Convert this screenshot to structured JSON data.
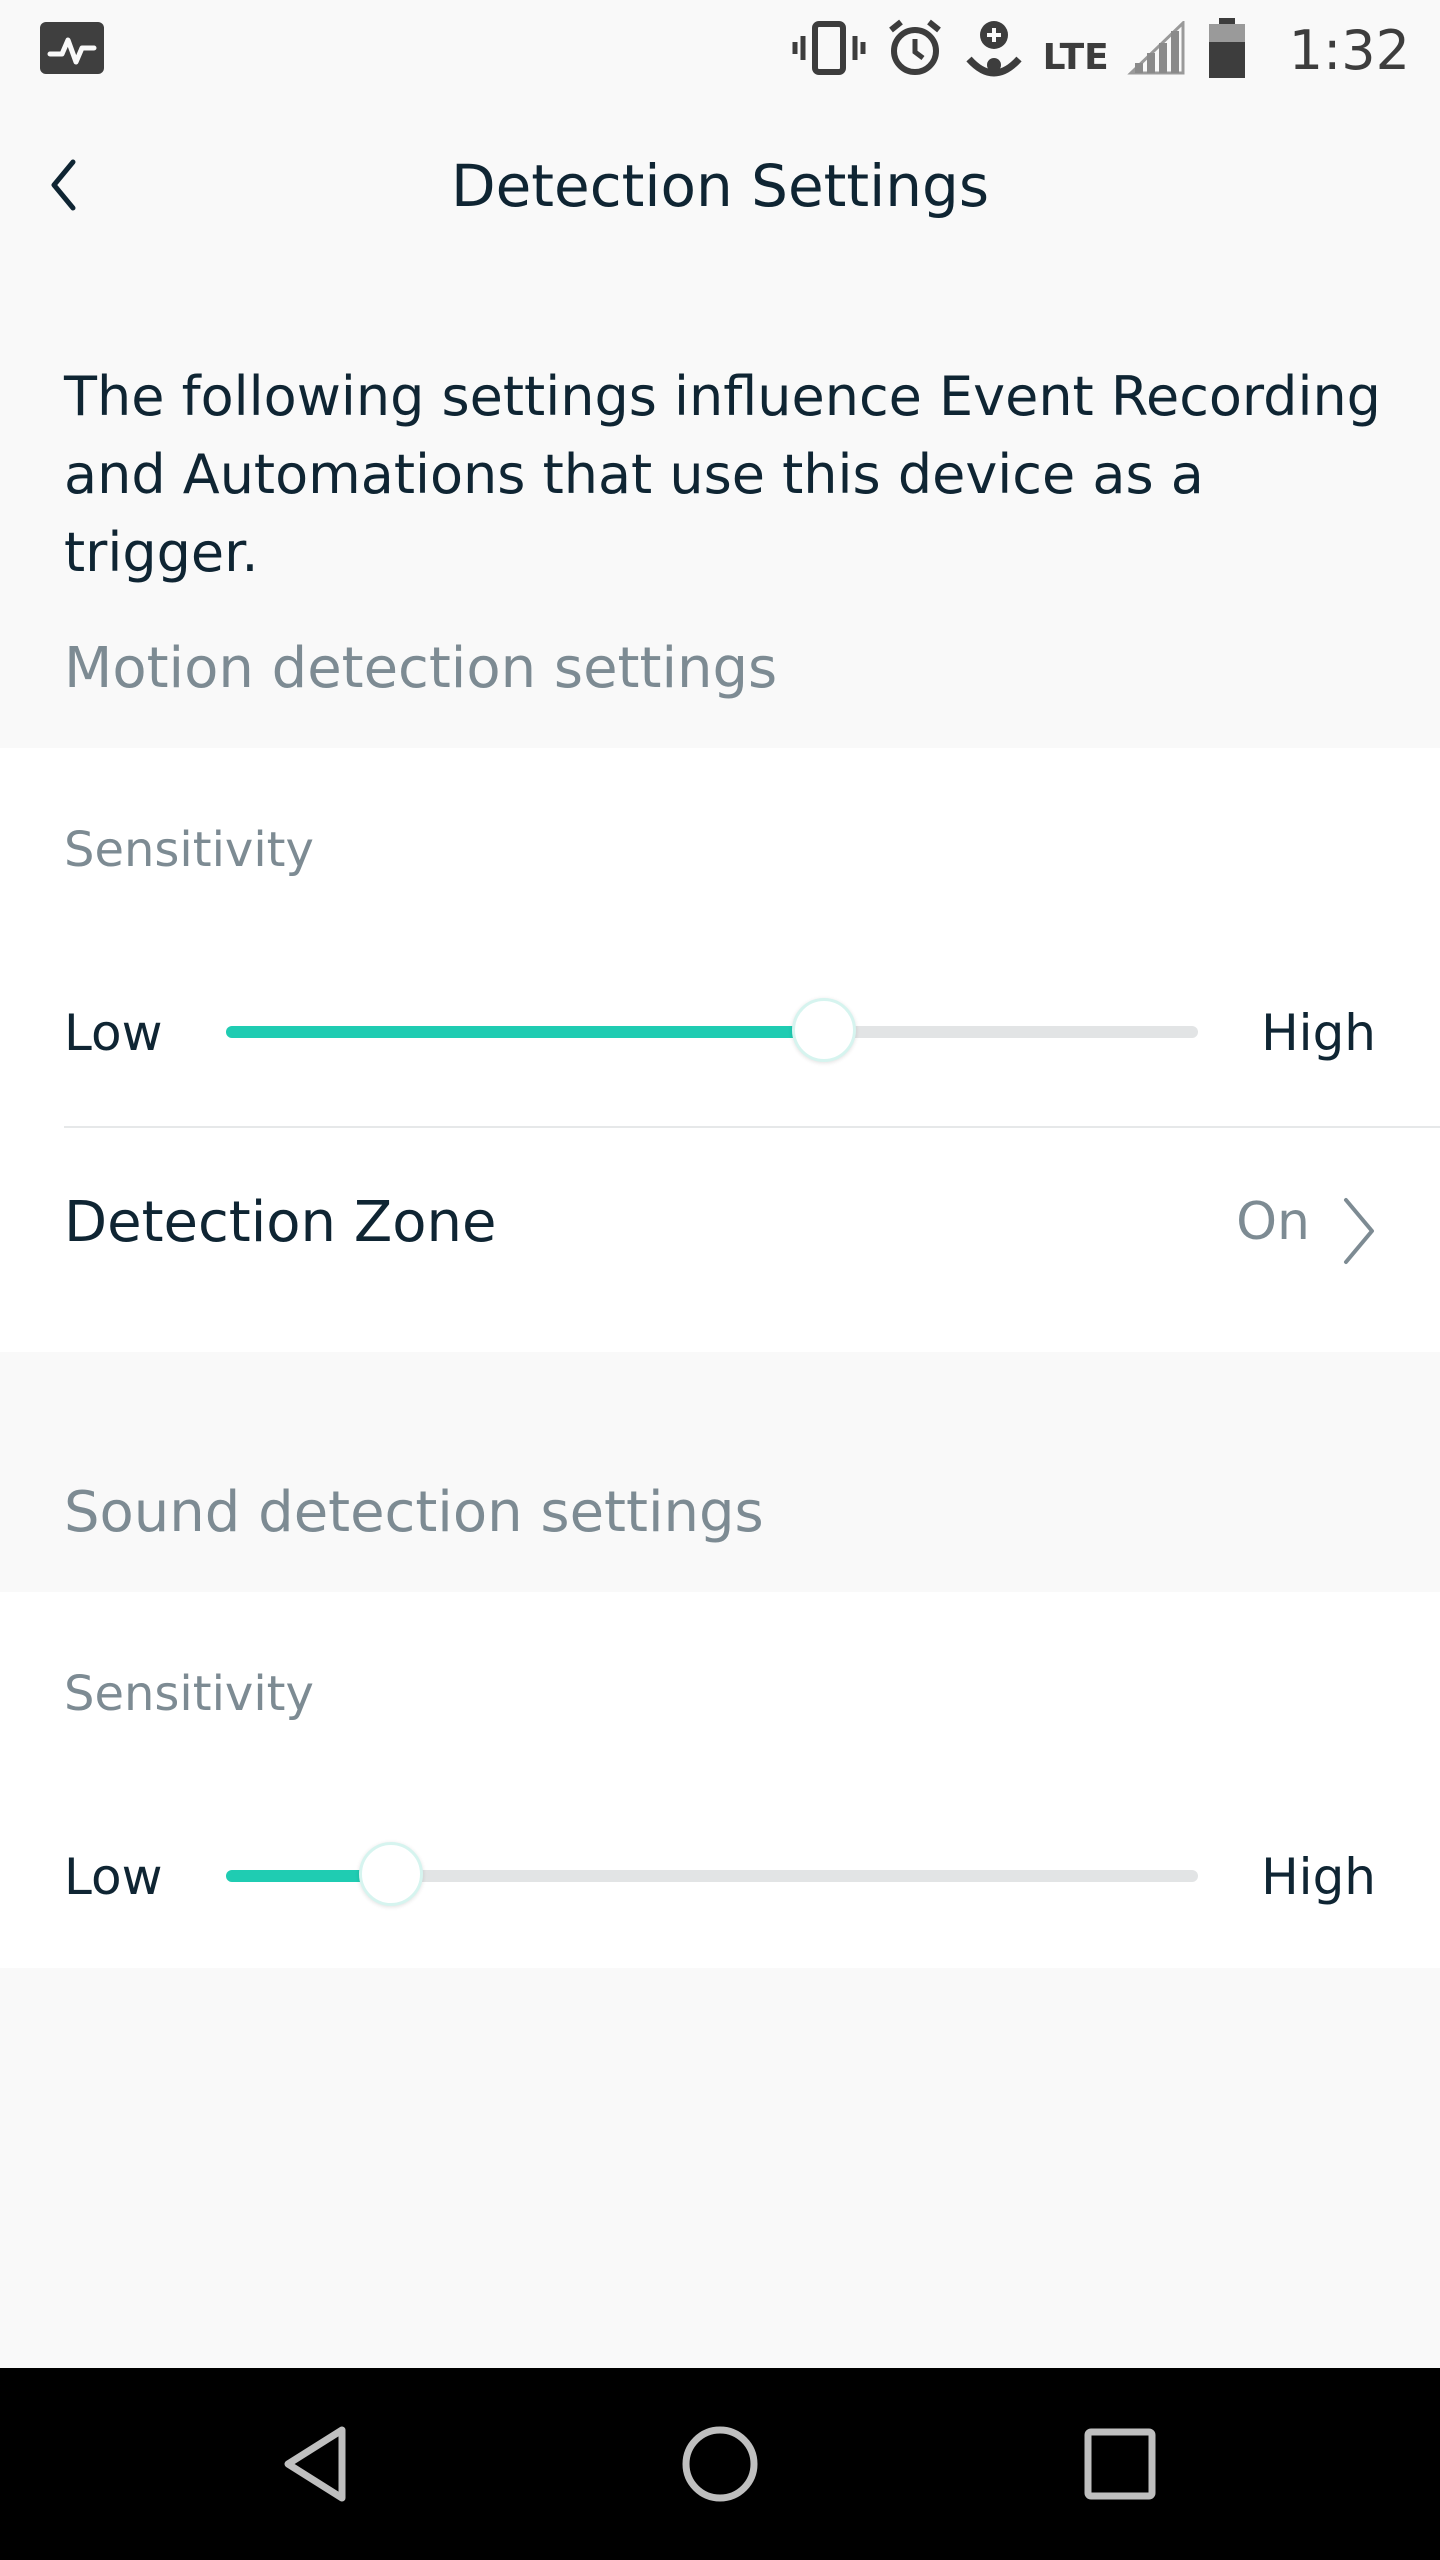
{
  "status_bar": {
    "time": "1:32",
    "network": "LTE",
    "icons": [
      "activity-icon",
      "vibrate-icon",
      "alarm-icon",
      "account-sync-icon",
      "signal-icon",
      "battery-icon"
    ]
  },
  "header": {
    "title": "Detection Settings",
    "back_icon": "chevron-left-icon"
  },
  "intro": {
    "text": "The following settings influence Event Recording and Automations that use this device as a trigger."
  },
  "motion": {
    "header": "Motion detection settings",
    "sensitivity_label": "Sensitivity",
    "low_label": "Low",
    "high_label": "High",
    "value": 0.615,
    "detection_zone_label": "Detection Zone",
    "detection_zone_value": "On"
  },
  "sound": {
    "header": "Sound detection settings",
    "sensitivity_label": "Sensitivity",
    "low_label": "Low",
    "high_label": "High",
    "value": 0.17
  },
  "colors": {
    "accent": "#1fccb2",
    "text_primary": "#0f2533",
    "text_secondary": "#7d8b93",
    "background": "#f9f9f9",
    "card": "#ffffff"
  },
  "nav_bar": {
    "icons": [
      "back-triangle-icon",
      "home-circle-icon",
      "recents-square-icon"
    ]
  }
}
